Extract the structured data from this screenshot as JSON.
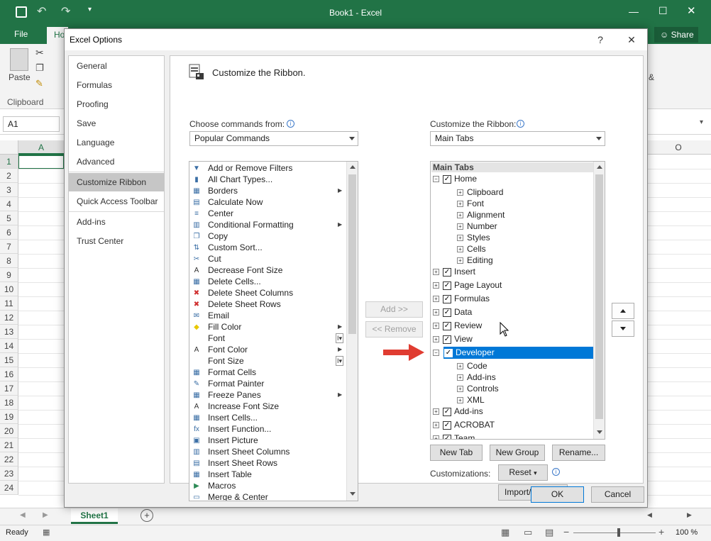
{
  "excel": {
    "window_title": "Book1 - Excel",
    "tabs": {
      "file": "File",
      "home": "Ho"
    },
    "share": "Share",
    "paste": "Paste",
    "clipboard_group": "Clipboard",
    "name_box": "A1",
    "col_a": "A",
    "col_o": "O",
    "rows": [
      "1",
      "2",
      "3",
      "4",
      "5",
      "6",
      "7",
      "8",
      "9",
      "10",
      "11",
      "12",
      "13",
      "14",
      "15",
      "16",
      "17",
      "18",
      "19",
      "20",
      "21",
      "22",
      "23",
      "24"
    ],
    "sheet_tab": "Sheet1",
    "status": "Ready",
    "zoom": "100 %"
  },
  "dialog": {
    "title": "Excel Options",
    "help": "?",
    "close": "✕",
    "nav": [
      {
        "label": "General"
      },
      {
        "label": "Formulas"
      },
      {
        "label": "Proofing"
      },
      {
        "label": "Save"
      },
      {
        "label": "Language"
      },
      {
        "label": "Advanced"
      },
      {
        "label": "Customize Ribbon",
        "selected": true
      },
      {
        "label": "Quick Access Toolbar"
      },
      {
        "label": "Add-ins"
      },
      {
        "label": "Trust Center"
      }
    ],
    "heading": "Customize the Ribbon.",
    "choose_label": "Choose commands from:",
    "choose_value": "Popular Commands",
    "customize_label": "Customize the Ribbon:",
    "customize_value": "Main Tabs",
    "commands": [
      {
        "label": "Add or Remove Filters",
        "icon": "filter-icon",
        "glyph": "▼"
      },
      {
        "label": "All Chart Types...",
        "icon": "chart-icon",
        "glyph": "▮"
      },
      {
        "label": "Borders",
        "icon": "borders-icon",
        "glyph": "▦",
        "sub": "▶"
      },
      {
        "label": "Calculate Now",
        "icon": "calculator-icon",
        "glyph": "▤"
      },
      {
        "label": "Center",
        "icon": "center-align-icon",
        "glyph": "≡"
      },
      {
        "label": "Conditional Formatting",
        "icon": "conditional-format-icon",
        "glyph": "▥",
        "sub": "▶"
      },
      {
        "label": "Copy",
        "icon": "copy-icon",
        "glyph": "❐"
      },
      {
        "label": "Custom Sort...",
        "icon": "sort-icon",
        "glyph": "⇅"
      },
      {
        "label": "Cut",
        "icon": "cut-icon",
        "glyph": "✂"
      },
      {
        "label": "Decrease Font Size",
        "icon": "decrease-font-icon",
        "glyph": "A"
      },
      {
        "label": "Delete Cells...",
        "icon": "delete-cells-icon",
        "glyph": "▦"
      },
      {
        "label": "Delete Sheet Columns",
        "icon": "delete-columns-icon",
        "glyph": "✖"
      },
      {
        "label": "Delete Sheet Rows",
        "icon": "delete-rows-icon",
        "glyph": "✖"
      },
      {
        "label": "Email",
        "icon": "email-icon",
        "glyph": "✉"
      },
      {
        "label": "Fill Color",
        "icon": "fill-color-icon",
        "glyph": "◆",
        "sub": "▶"
      },
      {
        "label": "Font",
        "icon": "font-icon",
        "glyph": "",
        "sub": "I▾"
      },
      {
        "label": "Font Color",
        "icon": "font-color-icon",
        "glyph": "A",
        "sub": "▶"
      },
      {
        "label": "Font Size",
        "icon": "font-size-icon",
        "glyph": "",
        "sub": "I▾"
      },
      {
        "label": "Format Cells",
        "icon": "format-cells-icon",
        "glyph": "▦"
      },
      {
        "label": "Format Painter",
        "icon": "format-painter-icon",
        "glyph": "✎"
      },
      {
        "label": "Freeze Panes",
        "icon": "freeze-panes-icon",
        "glyph": "▦",
        "sub": "▶"
      },
      {
        "label": "Increase Font Size",
        "icon": "increase-font-icon",
        "glyph": "A"
      },
      {
        "label": "Insert Cells...",
        "icon": "insert-cells-icon",
        "glyph": "▦"
      },
      {
        "label": "Insert Function...",
        "icon": "insert-function-icon",
        "glyph": "fx"
      },
      {
        "label": "Insert Picture",
        "icon": "insert-picture-icon",
        "glyph": "▣"
      },
      {
        "label": "Insert Sheet Columns",
        "icon": "insert-columns-icon",
        "glyph": "▥"
      },
      {
        "label": "Insert Sheet Rows",
        "icon": "insert-rows-icon",
        "glyph": "▤"
      },
      {
        "label": "Insert Table",
        "icon": "insert-table-icon",
        "glyph": "▦"
      },
      {
        "label": "Macros",
        "icon": "macros-icon",
        "glyph": "▶"
      },
      {
        "label": "Merge & Center",
        "icon": "merge-center-icon",
        "glyph": "▭"
      }
    ],
    "add_button": "Add >>",
    "remove_button": "<< Remove",
    "tree_header": "Main Tabs",
    "tree": [
      {
        "label": "Home",
        "level": 0,
        "expanded": true,
        "checked": true
      },
      {
        "label": "Clipboard",
        "level": 1
      },
      {
        "label": "Font",
        "level": 1
      },
      {
        "label": "Alignment",
        "level": 1
      },
      {
        "label": "Number",
        "level": 1
      },
      {
        "label": "Styles",
        "level": 1
      },
      {
        "label": "Cells",
        "level": 1
      },
      {
        "label": "Editing",
        "level": 1
      },
      {
        "label": "Insert",
        "level": 0,
        "checked": true
      },
      {
        "label": "Page Layout",
        "level": 0,
        "checked": true
      },
      {
        "label": "Formulas",
        "level": 0,
        "checked": true
      },
      {
        "label": "Data",
        "level": 0,
        "checked": true
      },
      {
        "label": "Review",
        "level": 0,
        "checked": true
      },
      {
        "label": "View",
        "level": 0,
        "checked": true
      },
      {
        "label": "Developer",
        "level": 0,
        "expanded": true,
        "checked": true,
        "selected": true
      },
      {
        "label": "Code",
        "level": 1
      },
      {
        "label": "Add-ins",
        "level": 1
      },
      {
        "label": "Controls",
        "level": 1
      },
      {
        "label": "XML",
        "level": 1
      },
      {
        "label": "Add-ins",
        "level": 0,
        "checked": true
      },
      {
        "label": "ACROBAT",
        "level": 0,
        "checked": true
      },
      {
        "label": "Team",
        "level": 0,
        "checked": true
      }
    ],
    "new_tab": "New Tab",
    "new_group": "New Group",
    "rename": "Rename...",
    "customizations_label": "Customizations:",
    "reset": "Reset",
    "import_export": "Import/Export",
    "ok": "OK",
    "cancel": "Cancel",
    "arrow_color": "#e03c31",
    "selection_color": "#0078d7",
    "excel_green": "#217346"
  }
}
